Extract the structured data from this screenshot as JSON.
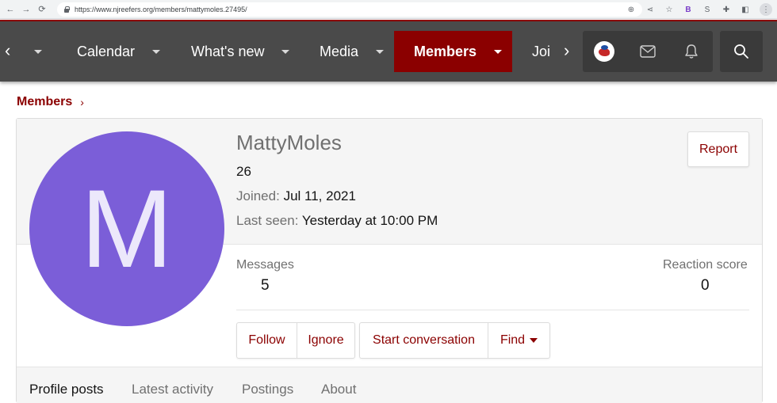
{
  "browser": {
    "url": "https://www.njreefers.org/members/mattymoles.27495/"
  },
  "nav": {
    "items": [
      {
        "label": "Calendar"
      },
      {
        "label": "What's new"
      },
      {
        "label": "Media"
      },
      {
        "label": "Members"
      },
      {
        "label": "Joi"
      }
    ]
  },
  "breadcrumb": {
    "label": "Members"
  },
  "profile": {
    "avatar_letter": "M",
    "avatar_color": "#7b5ed8",
    "username": "MattyMoles",
    "title": "26",
    "joined_label": "Joined:",
    "joined_value": "Jul 11, 2021",
    "last_seen_label": "Last seen:",
    "last_seen_value": "Yesterday at 10:00 PM",
    "report_label": "Report"
  },
  "stats": {
    "messages_label": "Messages",
    "messages_value": "5",
    "reaction_label": "Reaction score",
    "reaction_value": "0"
  },
  "actions": {
    "follow": "Follow",
    "ignore": "Ignore",
    "start_conversation": "Start conversation",
    "find": "Find"
  },
  "tabs": [
    {
      "label": "Profile posts"
    },
    {
      "label": "Latest activity"
    },
    {
      "label": "Postings"
    },
    {
      "label": "About"
    }
  ],
  "colors": {
    "accent": "#8b0000",
    "nav_bg": "#4a4a4a"
  }
}
